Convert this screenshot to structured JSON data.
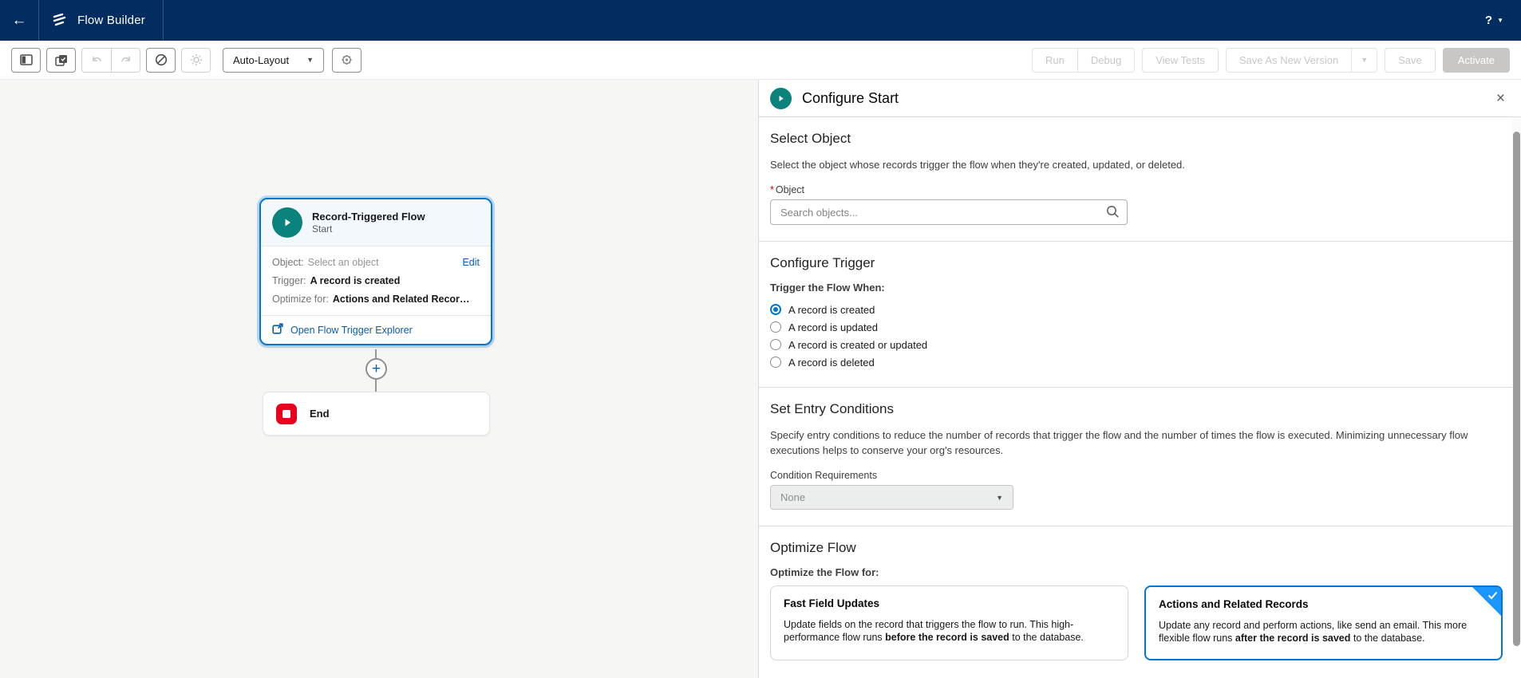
{
  "colors": {
    "brand_navy": "#032d60",
    "accent_blue": "#0176d3",
    "link_blue": "#0b5cab",
    "start_teal": "#0b827c",
    "end_red": "#ea001e",
    "selected_ribbon_blue": "#1b96ff"
  },
  "header": {
    "app_title": "Flow Builder",
    "help_label": "?"
  },
  "toolbar": {
    "auto_layout_label": "Auto-Layout",
    "run_label": "Run",
    "debug_label": "Debug",
    "view_tests_label": "View Tests",
    "save_as_new_version_label": "Save As New Version",
    "save_label": "Save",
    "activate_label": "Activate"
  },
  "canvas": {
    "start_node": {
      "title": "Record-Triggered Flow",
      "subtitle": "Start",
      "object_label": "Object:",
      "object_value": "Select an object",
      "edit_label": "Edit",
      "trigger_label": "Trigger:",
      "trigger_value": "A record is created",
      "optimize_label": "Optimize for:",
      "optimize_value": "Actions and Related Records",
      "footer_link": "Open Flow Trigger Explorer"
    },
    "add_button": "+",
    "end_node": {
      "label": "End"
    }
  },
  "panel": {
    "title": "Configure Start",
    "close_icon": "×",
    "select_object": {
      "heading": "Select Object",
      "description": "Select the object whose records trigger the flow when they're created, updated, or deleted.",
      "required_mark": "*",
      "field_label": "Object",
      "placeholder": "Search objects..."
    },
    "configure_trigger": {
      "heading": "Configure Trigger",
      "group_label": "Trigger the Flow When:",
      "options": [
        {
          "label": "A record is created",
          "selected": true
        },
        {
          "label": "A record is updated",
          "selected": false
        },
        {
          "label": "A record is created or updated",
          "selected": false
        },
        {
          "label": "A record is deleted",
          "selected": false
        }
      ]
    },
    "entry_conditions": {
      "heading": "Set Entry Conditions",
      "description": "Specify entry conditions to reduce the number of records that trigger the flow and the number of times the flow is executed. Minimizing unnecessary flow executions helps to conserve your org's resources.",
      "field_label": "Condition Requirements",
      "value": "None"
    },
    "optimize_flow": {
      "heading": "Optimize Flow",
      "group_label": "Optimize the Flow for:",
      "cards": [
        {
          "title": "Fast Field Updates",
          "body_pre": "Update fields on the record that triggers the flow to run. This high-performance flow runs ",
          "body_bold": "before the record is saved",
          "body_post": " to the database.",
          "selected": false
        },
        {
          "title": "Actions and Related Records",
          "body_pre": "Update any record and perform actions, like send an email. This more flexible flow runs ",
          "body_bold": "after the record is saved",
          "body_post": " to the database.",
          "selected": true
        }
      ]
    }
  }
}
